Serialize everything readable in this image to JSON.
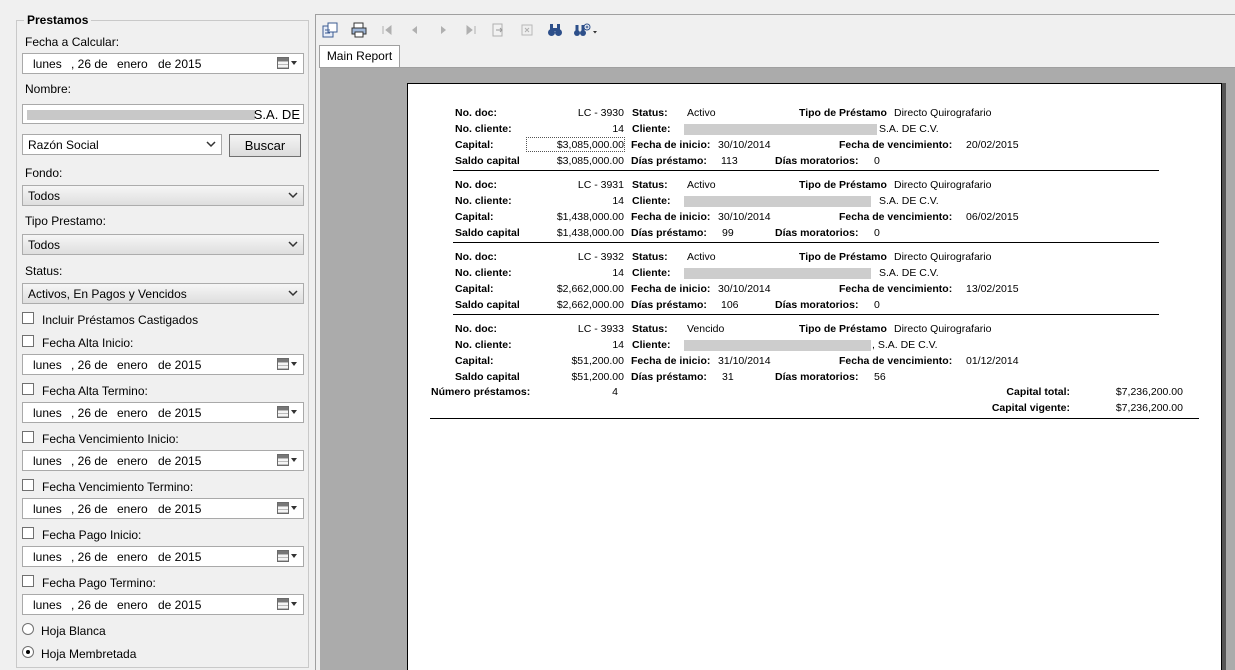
{
  "panel": {
    "title": "Prestamos",
    "fecha_calcular_label": "Fecha a Calcular:",
    "nombre_label": "Nombre:",
    "nombre_value_tail": "S.A. DE",
    "search_type_value": "Razón Social",
    "buscar_label": "Buscar",
    "fondo_label": "Fondo:",
    "fondo_value": "Todos",
    "tipo_label": "Tipo Prestamo:",
    "tipo_value": "Todos",
    "status_label": "Status:",
    "status_value": "Activos, En Pagos y Vencidos",
    "castigados_label": "Incluir Préstamos Castigados",
    "date": {
      "day_name": "lunes",
      "day": ", 26 de",
      "month": "enero",
      "year": "de 2015"
    },
    "filters": [
      {
        "label": "Fecha Alta Inicio:"
      },
      {
        "label": "Fecha Alta Termino:"
      },
      {
        "label": "Fecha Vencimiento Inicio:"
      },
      {
        "label": "Fecha Vencimiento Termino:"
      },
      {
        "label": "Fecha Pago Inicio:"
      },
      {
        "label": "Fecha Pago Termino:"
      }
    ],
    "radio_blanca": "Hoja Blanca",
    "radio_membretada": "Hoja Membretada",
    "selected_radio": "membretada"
  },
  "viewer": {
    "tab_label": "Main Report",
    "icons": [
      "export-icon",
      "print-icon",
      "first-page-icon",
      "prev-page-icon",
      "next-page-icon",
      "last-page-icon",
      "goto-page-icon",
      "stop-icon",
      "search-binoculars-icon",
      "zoom-icon"
    ]
  },
  "report": {
    "labels": {
      "no_doc": "No. doc:",
      "no_cliente": "No. cliente:",
      "capital": "Capital:",
      "saldo": "Saldo capital",
      "status": "Status:",
      "cliente": "Cliente:",
      "fecha_inicio": "Fecha de inicio:",
      "dias_prestamo": "Días préstamo:",
      "tipo": "Tipo de Préstamo",
      "fecha_venc": "Fecha de vencimiento:",
      "dias_mora": "Días moratorios:"
    },
    "loans": [
      {
        "doc": "LC - 3930",
        "cliente_no": "14",
        "capital": "$3,085,000.00",
        "saldo": "$3,085,000.00",
        "status": "Activo",
        "cliente_tail": "S.A. DE C.V.",
        "fecha_inicio": "30/10/2014",
        "dias": "113",
        "tipo": "Directo Quirografario",
        "fecha_venc": "20/02/2015",
        "mora": "0"
      },
      {
        "doc": "LC - 3931",
        "cliente_no": "14",
        "capital": "$1,438,000.00",
        "saldo": "$1,438,000.00",
        "status": "Activo",
        "cliente_tail": "S.A. DE C.V.",
        "fecha_inicio": "30/10/2014",
        "dias": "99",
        "tipo": "Directo Quirografario",
        "fecha_venc": "06/02/2015",
        "mora": "0"
      },
      {
        "doc": "LC - 3932",
        "cliente_no": "14",
        "capital": "$2,662,000.00",
        "saldo": "$2,662,000.00",
        "status": "Activo",
        "cliente_tail": "S.A. DE C.V.",
        "fecha_inicio": "30/10/2014",
        "dias": "106",
        "tipo": "Directo Quirografario",
        "fecha_venc": "13/02/2015",
        "mora": "0"
      },
      {
        "doc": "LC - 3933",
        "cliente_no": "14",
        "capital": "$51,200.00",
        "saldo": "$51,200.00",
        "status": "Vencido",
        "cliente_tail": ", S.A. DE C.V.",
        "fecha_inicio": "31/10/2014",
        "dias": "31",
        "tipo": "Directo Quirografario",
        "fecha_venc": "01/12/2014",
        "mora": "56"
      }
    ],
    "summary": {
      "num_label": "Número préstamos:",
      "num_value": "4",
      "capital_total_label": "Capital total:",
      "capital_total_value": "$7,236,200.00",
      "capital_vigente_label": "Capital vigente:",
      "capital_vigente_value": "$7,236,200.00"
    }
  }
}
